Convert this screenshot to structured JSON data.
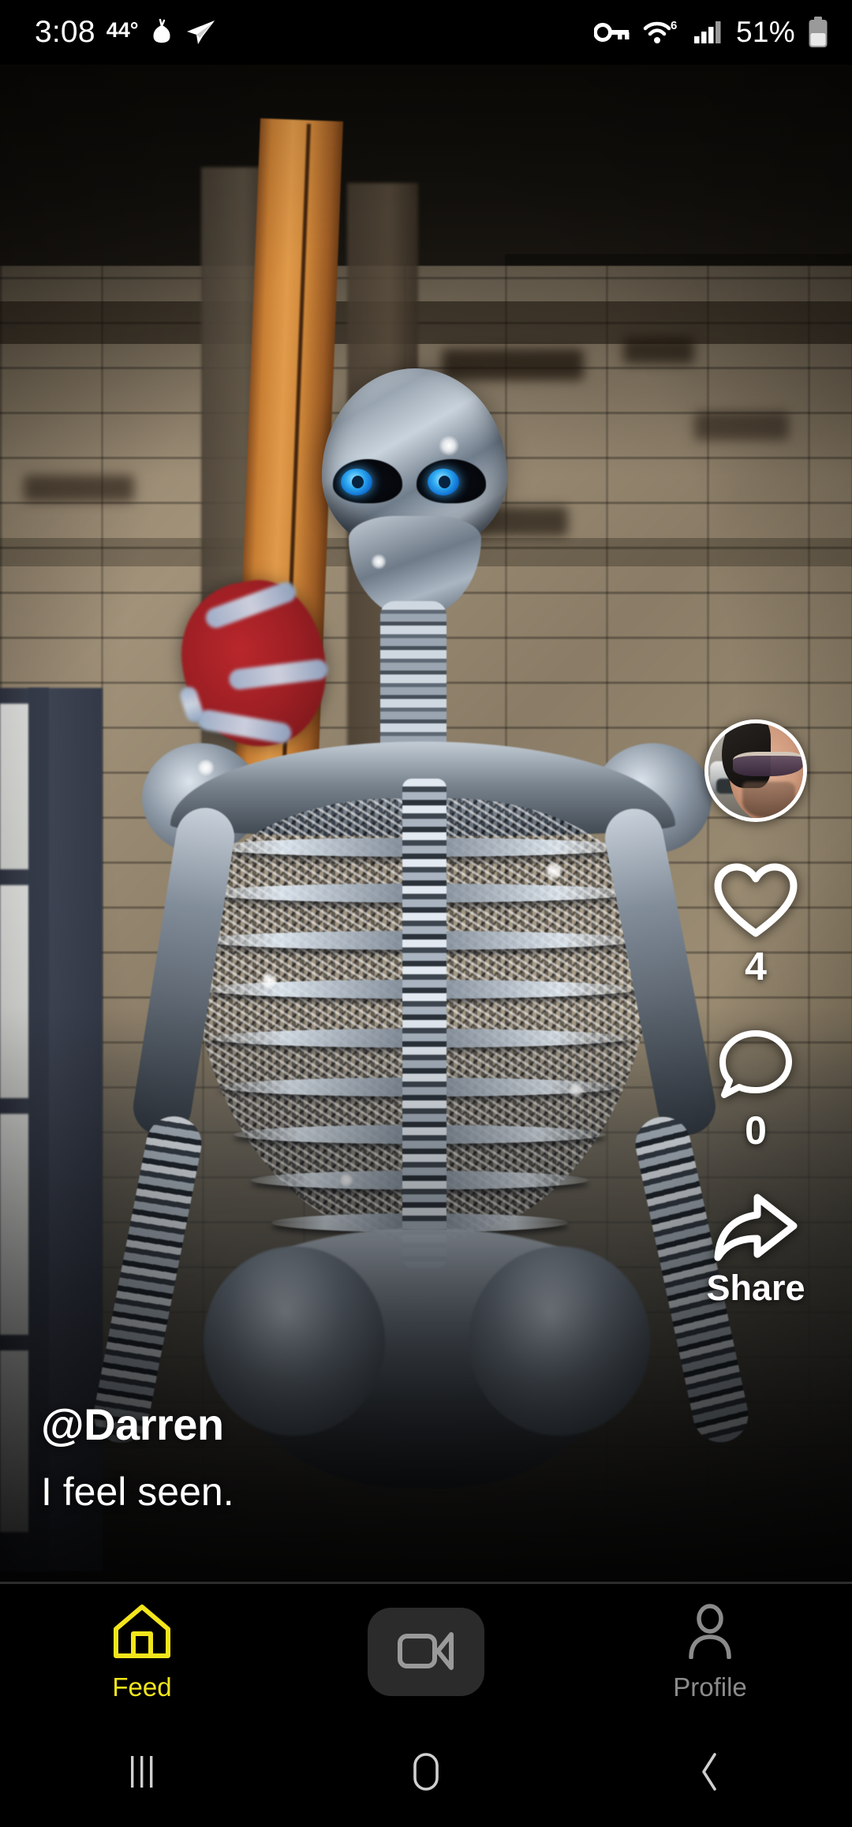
{
  "status_bar": {
    "time": "3:08",
    "temperature": "44°",
    "weather_icon": "onion-bulb-icon",
    "telegram_icon": "telegram-send-icon",
    "vpn_icon": "vpn-key-icon",
    "wifi_icon": "wifi-icon",
    "wifi_generation": "6",
    "signal_icon": "cellular-signal-icon",
    "battery_percent": "51%",
    "battery_icon": "battery-icon"
  },
  "video_post": {
    "description": "Mirror-mosaic skeleton sculpture with glowing blue eyes hanging in front of a brick wall and wooden beam",
    "author_handle": "@Darren",
    "caption": "I feel seen.",
    "avatar_alt": "profile-photo-man-with-sunglasses",
    "actions": {
      "like": {
        "icon": "heart-icon",
        "count": "4"
      },
      "comment": {
        "icon": "comment-bubble-icon",
        "count": "0"
      },
      "share": {
        "icon": "share-arrow-icon",
        "label": "Share"
      }
    }
  },
  "bottom_nav": {
    "items": [
      {
        "icon": "home-icon",
        "label": "Feed",
        "active": true
      },
      {
        "icon": "video-camera-icon",
        "label": "",
        "active": false
      },
      {
        "icon": "person-icon",
        "label": "Profile",
        "active": false
      }
    ]
  },
  "system_nav": {
    "recents_icon": "recents-icon",
    "home_icon": "home-circle-icon",
    "back_icon": "back-chevron-icon"
  },
  "colors": {
    "accent_yellow": "#F2E51B",
    "inactive_gray": "#8b8b8b",
    "background": "#000000",
    "record_button": "#2b2b2b"
  }
}
